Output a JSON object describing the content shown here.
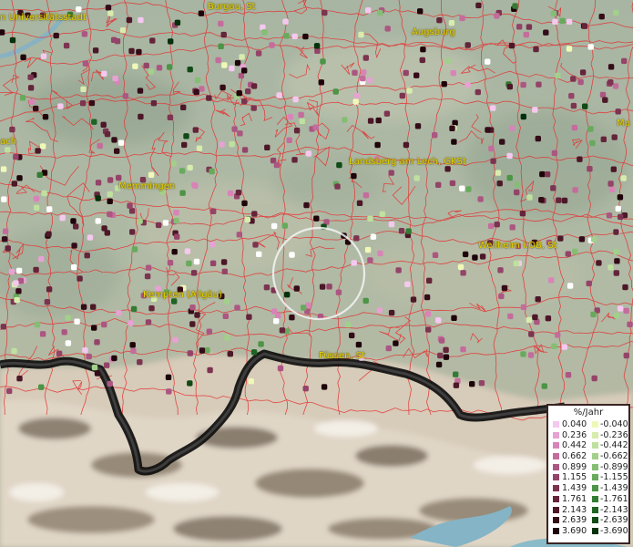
{
  "map": {
    "cities": [
      {
        "name": "n Universitätsstadt"
      },
      {
        "name": "Burgau, St"
      },
      {
        "name": "Augsburg"
      },
      {
        "name": "Mu"
      },
      {
        "name": "ach"
      },
      {
        "name": "Landsberg am Lech, GKSt"
      },
      {
        "name": "Memmingen"
      },
      {
        "name": "Weilheim i.OB, St"
      },
      {
        "name": "Kempten (Allgäu)"
      },
      {
        "name": "Füssen, St"
      }
    ]
  },
  "legend": {
    "title": "%/Jahr",
    "rows": [
      {
        "pos": "0.040",
        "neg": "-0.040",
        "pos_color": "#f5c8ef",
        "neg_color": "#f0f8b8"
      },
      {
        "pos": "0.236",
        "neg": "-0.236",
        "pos_color": "#e6a2d2",
        "neg_color": "#d7ecad"
      },
      {
        "pos": "0.442",
        "neg": "-0.442",
        "pos_color": "#d884b8",
        "neg_color": "#bfe09f"
      },
      {
        "pos": "0.662",
        "neg": "-0.662",
        "pos_color": "#c46c9c",
        "neg_color": "#a2d08b"
      },
      {
        "pos": "0.899",
        "neg": "-0.899",
        "pos_color": "#ac5682",
        "neg_color": "#84be73"
      },
      {
        "pos": "1.155",
        "neg": "-1.155",
        "pos_color": "#944468",
        "neg_color": "#67aa5c"
      },
      {
        "pos": "1.439",
        "neg": "-1.439",
        "pos_color": "#7c3450",
        "neg_color": "#4c9446"
      },
      {
        "pos": "1.761",
        "neg": "-1.761",
        "pos_color": "#64243a",
        "neg_color": "#337c33"
      },
      {
        "pos": "2.143",
        "neg": "-2.143",
        "pos_color": "#4c1828",
        "neg_color": "#1e6424"
      },
      {
        "pos": "2.639",
        "neg": "-2.639",
        "pos_color": "#340c18",
        "neg_color": "#104a16"
      },
      {
        "pos": "3.690",
        "neg": "-3.690",
        "pos_color": "#1e040a",
        "neg_color": "#06300c"
      }
    ]
  }
}
